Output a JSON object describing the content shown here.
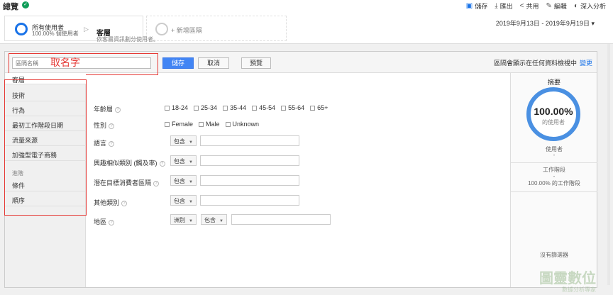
{
  "header": {
    "title": "總覽",
    "toolbar": [
      {
        "label": "儲存",
        "icon": "save-icon"
      },
      {
        "label": "匯出",
        "icon": "export-icon"
      },
      {
        "label": "共用",
        "icon": "share-icon"
      },
      {
        "label": "編輯",
        "icon": "edit-icon"
      },
      {
        "label": "深入分析",
        "icon": "insights-icon"
      }
    ]
  },
  "segments": {
    "active": {
      "name": "所有使用者",
      "sub": "100.00% 個使用者"
    },
    "add_label": "+ 新增區隔",
    "date_range": "2019年9月13日 - 2019年9月19日"
  },
  "editor": {
    "name_placeholder": "區隔名稱",
    "annotation": "取名字",
    "save": "儲存",
    "cancel": "取消",
    "preview": "預覽",
    "visibility_text": "區隔會顯示在任何資料檢視中",
    "visibility_link": "變更"
  },
  "nav": {
    "items": [
      "客層",
      "技術",
      "行為",
      "最初工作階段日期",
      "流量來源",
      "加強型電子商務"
    ],
    "advanced_header": "進階",
    "advanced_items": [
      "條件",
      "順序"
    ]
  },
  "form": {
    "title": "客層",
    "subtitle": "依客層資訊劃分使用者。",
    "age_label": "年齡層",
    "ages": [
      "18-24",
      "25-34",
      "35-44",
      "45-54",
      "55-64",
      "65+"
    ],
    "gender_label": "性別",
    "genders": [
      "Female",
      "Male",
      "Unknown"
    ],
    "language_label": "語言",
    "affinity_label": "興趣相似類別 (觸及率)",
    "inmarket_label": "潛在目標消費者區隔",
    "other_label": "其他類別",
    "location_label": "地區",
    "contains": "包含",
    "continent": "洲別"
  },
  "summary": {
    "title": "摘要",
    "percent": "100.00%",
    "percent_sub": "的使用者",
    "users_label": "使用者",
    "users_value": "-",
    "sessions_label": "工作階段",
    "sessions_value": "-",
    "sessions_pct": "100.00% 的工作階段",
    "no_filter": "沒有篩選器"
  },
  "watermark": {
    "title": "圖靈數位",
    "sub": "數據分析專家"
  },
  "colors": {
    "accent": "#4285f4",
    "annotation": "#e53935",
    "verified": "#0f9d58"
  }
}
